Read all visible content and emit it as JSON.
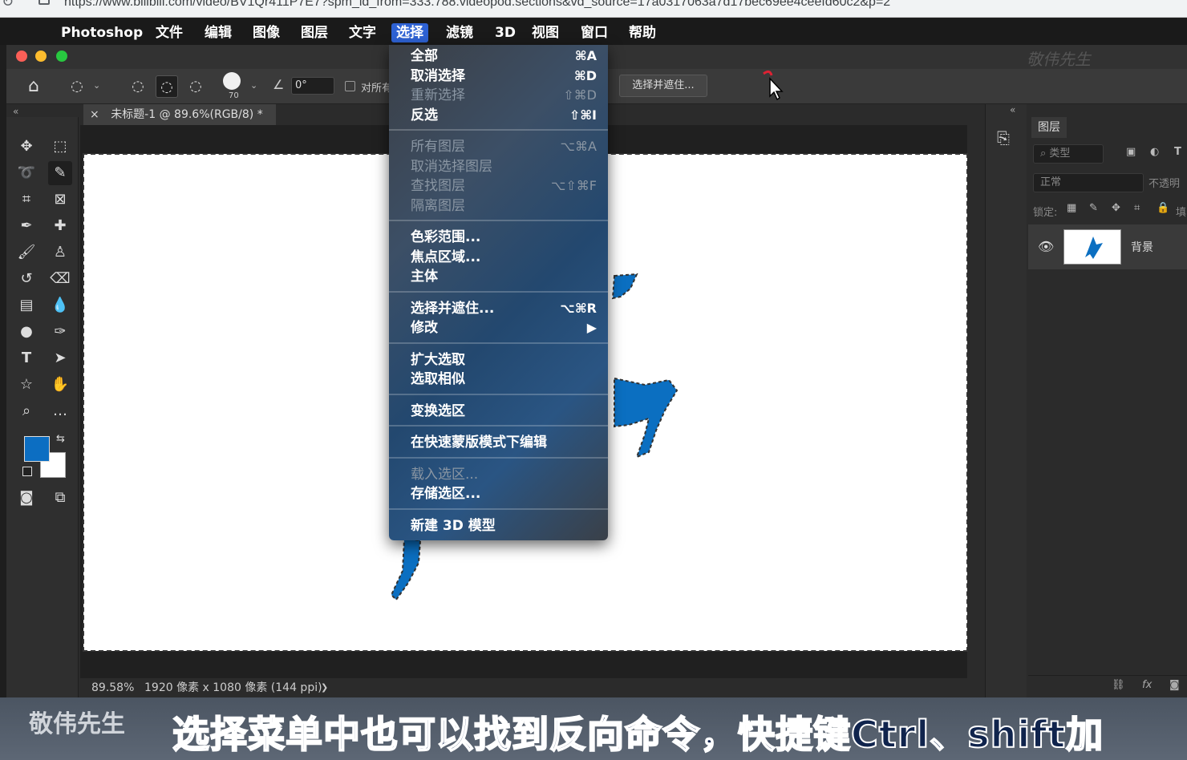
{
  "browser": {
    "url": "https://www.bilibili.com/video/BV1Qr411P7E7?spm_id_from=333.788.videopod.sections&vd_source=17a0317063a7d17bec69ee4ceefd60c2&p=2"
  },
  "menubar": {
    "app_name": "Photoshop",
    "items": [
      "文件",
      "编辑",
      "图像",
      "图层",
      "文字",
      "选择",
      "滤镜",
      "3D",
      "视图",
      "窗口",
      "帮助"
    ],
    "active_item": "选择"
  },
  "titlebar": {
    "watermark": "敬伟先生"
  },
  "options_bar": {
    "brush_size": "70",
    "angle": "0°",
    "align_label": "对所有",
    "select_mask_button": "选择并遮住..."
  },
  "document": {
    "tab_close": "×",
    "tab_title": "未标题-1 @ 89.6%(RGB/8) *"
  },
  "status": {
    "zoom": "89.58%",
    "dimensions": "1920 像素 x 1080 像素 (144 ppi)",
    "arrow": "❯"
  },
  "layers_panel": {
    "tab_label": "图层",
    "search_placeholder": "类型",
    "blend_mode": "正常",
    "opacity_label": "不透明",
    "lock_label": "锁定:",
    "fill_label": "填",
    "layer_name": "背景"
  },
  "select_menu": {
    "groups": [
      [
        {
          "label": "全部",
          "shortcut": "⌘A",
          "disabled": false
        },
        {
          "label": "取消选择",
          "shortcut": "⌘D",
          "disabled": false
        },
        {
          "label": "重新选择",
          "shortcut": "⇧⌘D",
          "disabled": true
        },
        {
          "label": "反选",
          "shortcut": "⇧⌘I",
          "disabled": false
        }
      ],
      [
        {
          "label": "所有图层",
          "shortcut": "⌥⌘A",
          "disabled": true
        },
        {
          "label": "取消选择图层",
          "shortcut": "",
          "disabled": true
        },
        {
          "label": "查找图层",
          "shortcut": "⌥⇧⌘F",
          "disabled": true
        },
        {
          "label": "隔离图层",
          "shortcut": "",
          "disabled": true
        }
      ],
      [
        {
          "label": "色彩范围...",
          "shortcut": "",
          "disabled": false
        },
        {
          "label": "焦点区域...",
          "shortcut": "",
          "disabled": false
        },
        {
          "label": "主体",
          "shortcut": "",
          "disabled": false
        }
      ],
      [
        {
          "label": "选择并遮住...",
          "shortcut": "⌥⌘R",
          "disabled": false
        },
        {
          "label": "修改",
          "shortcut": "▶",
          "disabled": false
        }
      ],
      [
        {
          "label": "扩大选取",
          "shortcut": "",
          "disabled": false
        },
        {
          "label": "选取相似",
          "shortcut": "",
          "disabled": false
        }
      ],
      [
        {
          "label": "变换选区",
          "shortcut": "",
          "disabled": false
        }
      ],
      [
        {
          "label": "在快速蒙版模式下编辑",
          "shortcut": "",
          "disabled": false
        }
      ],
      [
        {
          "label": "载入选区...",
          "shortcut": "",
          "disabled": true
        },
        {
          "label": "存储选区...",
          "shortcut": "",
          "disabled": false
        }
      ],
      [
        {
          "label": "新建 3D 模型",
          "shortcut": "",
          "disabled": false
        }
      ]
    ]
  },
  "subtitle": {
    "text": "选择菜单中也可以找到反向命令，快捷键Ctrl、shift加",
    "watermark": "敬伟先生"
  },
  "colors": {
    "foreground": "#0c6ec2",
    "background": "#ffffff",
    "menu_highlight": "#2e62d4"
  }
}
